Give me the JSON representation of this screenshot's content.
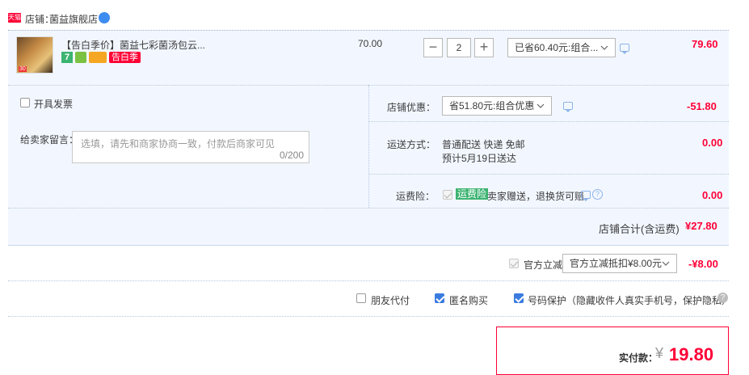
{
  "shop": {
    "badge": "天猫",
    "label": "店铺：",
    "name": "菌益旗舰店"
  },
  "item": {
    "title": "【告白季价】菌益七彩菌汤包云...",
    "unit_price": "70.00",
    "quantity": "2",
    "discount_select": "已省60.40元:组合...",
    "subtotal": "79.60",
    "badge_7": "7",
    "promo_tag": "告白季",
    "thumb_text": "30"
  },
  "invoice": {
    "label": "开具发票"
  },
  "message": {
    "label": "给卖家留言：",
    "placeholder": "选填，请先和商家协商一致，付款后商家可见",
    "counter": "0/200"
  },
  "shop_discount": {
    "label": "店铺优惠：",
    "select": "省51.80元:组合优惠",
    "amount": "-51.80"
  },
  "shipping": {
    "label": "运送方式：",
    "method": "普通配送 快递 免邮",
    "eta": "预计5月19日送达",
    "amount": "0.00"
  },
  "insurance": {
    "label": "运费险：",
    "tag": "运费险",
    "desc": "卖家赠送，退换货可赔",
    "amount": "0.00"
  },
  "shop_total": {
    "label": "店铺合计(含运费)",
    "amount": "¥27.80"
  },
  "official": {
    "label": "官方立减",
    "select": "官方立减抵扣¥8.00元",
    "amount": "-¥8.00"
  },
  "options": {
    "friend_pay": "朋友代付",
    "anonymous": "匿名购买",
    "number_protect": "号码保护（隐藏收件人真实手机号，保护隐私）"
  },
  "payment": {
    "label": "实付款：",
    "currency": "¥",
    "amount": "19.80"
  },
  "colors": {
    "accent_red": "#ff0036",
    "highlight_bg": "#f2f7ff",
    "checkbox_blue": "#3a7be0",
    "tag_green": "#3cb371"
  }
}
